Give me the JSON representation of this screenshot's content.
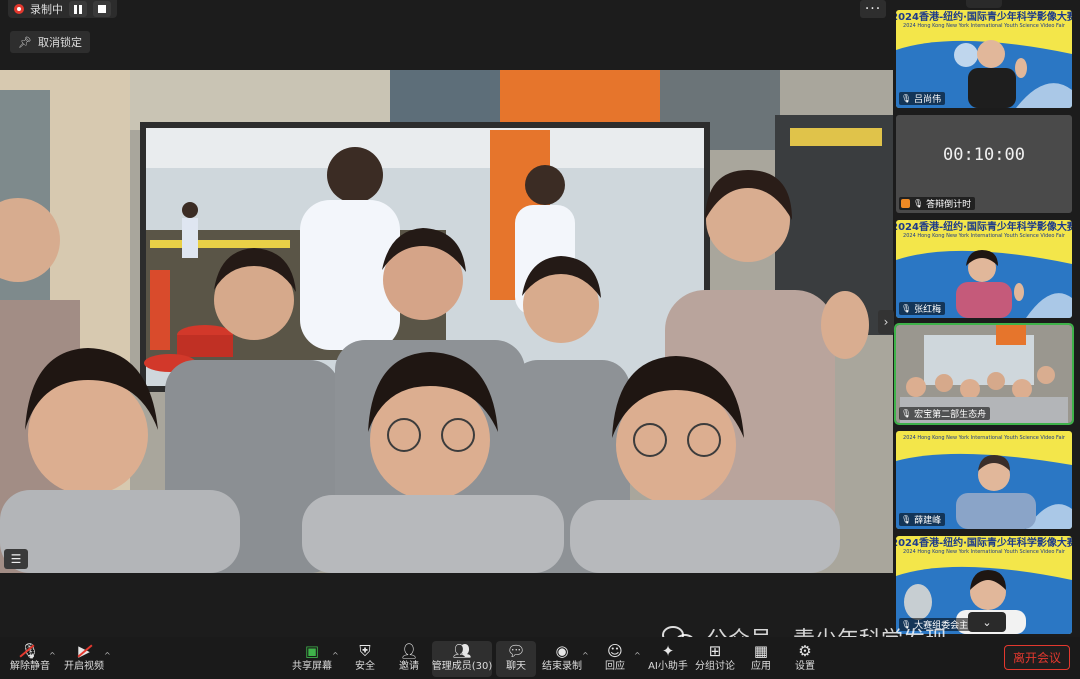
{
  "recording": {
    "label": "录制中"
  },
  "unpin": {
    "label": "取消锁定"
  },
  "more": {
    "label": "···"
  },
  "strip": {
    "tiles": [
      {
        "name": "吕尚伟",
        "banner_title": "2024香港-纽约·国际青少年科学影像大赛",
        "banner_subtitle": "2024 Hong Kong New York International Youth Science Video Fair"
      },
      {
        "name": "答辩倒计时",
        "timer": "00:10:00"
      },
      {
        "name": "张红梅",
        "banner_title": "2024香港-纽约·国际青少年科学影像大赛",
        "banner_subtitle": "2024 Hong Kong New York International Youth Science Video Fair"
      },
      {
        "name": "宏宝第二部生态舟"
      },
      {
        "name": "薛建峰",
        "banner_subtitle": "2024 Hong Kong New York International Youth Science Video Fair"
      },
      {
        "name": "大赛组委会主席",
        "banner_title": "2024香港-纽约·国际青少年科学影像大赛",
        "banner_subtitle": "2024 Hong Kong New York International Youth Science Video Fair"
      }
    ]
  },
  "toolbar": {
    "unmute": "解除静音",
    "start_video": "开启视频",
    "share_screen": "共享屏幕",
    "security": "安全",
    "invite": "邀请",
    "manage_members": "管理成员(30)",
    "chat": "聊天",
    "end_recording": "结束录制",
    "reactions": "回应",
    "ai_assistant": "AI小助手",
    "breakout": "分组讨论",
    "apps": "应用",
    "settings": "设置",
    "leave": "离开会议"
  },
  "watermark": {
    "text": "公众号 · 青少年科学发现"
  },
  "colors": {
    "leave": "#e3382e",
    "active_border": "#3fb24a",
    "banner_yellow": "#f3e64a",
    "banner_blue": "#2b77c4"
  }
}
